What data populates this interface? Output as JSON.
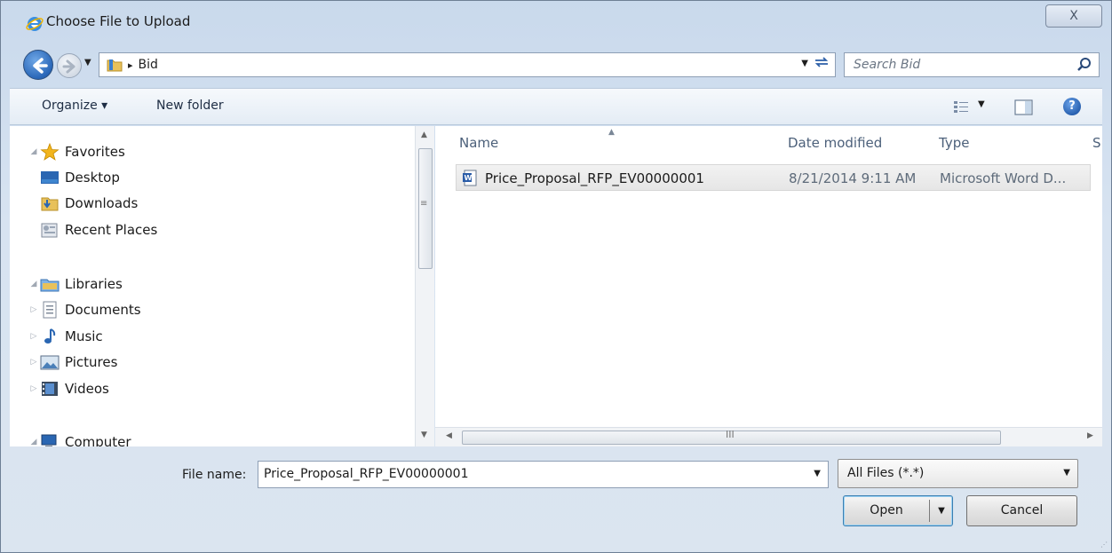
{
  "window": {
    "title": "Choose File to Upload",
    "close_label": "X"
  },
  "address": {
    "breadcrumb_separator": "▸",
    "current_folder": "Bid"
  },
  "search": {
    "placeholder": "Search Bid"
  },
  "toolbar": {
    "organize_label": "Organize ▾",
    "new_folder_label": "New folder"
  },
  "nav": {
    "favorites": {
      "label": "Favorites",
      "items": [
        "Desktop",
        "Downloads",
        "Recent Places"
      ]
    },
    "libraries": {
      "label": "Libraries",
      "items": [
        "Documents",
        "Music",
        "Pictures",
        "Videos"
      ]
    },
    "computer_label": "Computer"
  },
  "file_list": {
    "columns": [
      "Name",
      "Date modified",
      "Type",
      "S"
    ],
    "rows": [
      {
        "name": "Price_Proposal_RFP_EV00000001",
        "date_modified": "8/21/2014 9:11 AM",
        "type": "Microsoft Word D..."
      }
    ]
  },
  "footer": {
    "file_name_label": "File name:",
    "file_name_value": "Price_Proposal_RFP_EV00000001",
    "filter_value": "All Files (*.*)",
    "open_label": "Open",
    "cancel_label": "Cancel"
  },
  "colors": {
    "accent": "#2a67b8",
    "selection_bg": "#e6e6e6"
  }
}
